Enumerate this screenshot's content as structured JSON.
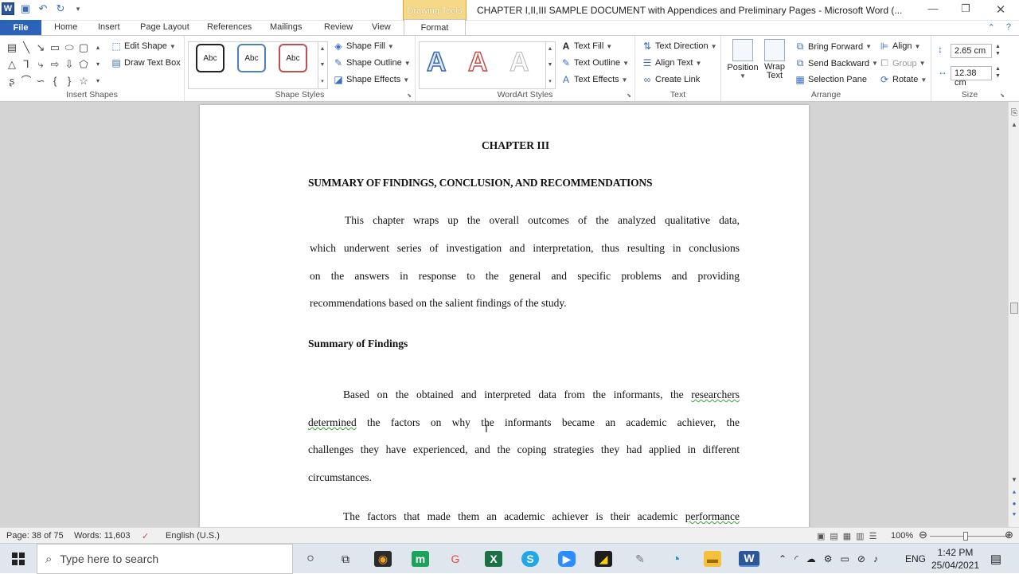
{
  "titlebar": {
    "app_icon": "W",
    "context_tab": "Drawing Tools",
    "title": "CHAPTER I,II,III SAMPLE DOCUMENT with Appendices and Preliminary Pages  -  Microsoft Word (..."
  },
  "tabs": [
    "File",
    "Home",
    "Insert",
    "Page Layout",
    "References",
    "Mailings",
    "Review",
    "View",
    "Format"
  ],
  "ribbon": {
    "insert_shapes": {
      "label": "Insert Shapes",
      "edit_shape": "Edit Shape",
      "draw_text_box": "Draw Text Box"
    },
    "shape_styles": {
      "label": "Shape Styles",
      "sample": "Abc",
      "fill": "Shape Fill",
      "outline": "Shape Outline",
      "effects": "Shape Effects"
    },
    "wordart": {
      "label": "WordArt Styles",
      "letter": "A",
      "text_fill": "Text Fill",
      "text_outline": "Text Outline",
      "text_effects": "Text Effects"
    },
    "text": {
      "label": "Text",
      "direction": "Text Direction",
      "align": "Align Text",
      "link": "Create Link"
    },
    "arrange": {
      "label": "Arrange",
      "position": "Position",
      "wrap_text": "Wrap Text",
      "bring_forward": "Bring Forward",
      "send_backward": "Send Backward",
      "selection_pane": "Selection Pane",
      "align": "Align",
      "group": "Group",
      "rotate": "Rotate"
    },
    "size": {
      "label": "Size",
      "height": "2.65 cm",
      "width": "12.38 cm"
    }
  },
  "document": {
    "chapter": "CHAPTER III",
    "heading": "SUMMARY OF FINDINGS, CONCLUSION, AND RECOMMENDATIONS",
    "para1": [
      "This  chapter  wraps  up  the  overall  outcomes  of  the  analyzed  qualitative  data,",
      "which  underwent  series  of  investigation  and  interpretation,  thus  resulting  in  conclusions",
      "on  the  answers  in  response  to  the  general  and  specific  problems  and  providing",
      "recommendations based on the salient findings of the study."
    ],
    "subheading": "Summary of Findings",
    "para2": {
      "line1_pre": "Based on the obtained and interpreted data from the informants, the ",
      "line1_err": "researchers",
      "line2_err": "determined",
      "line2_post": "  the  factors  on  why  the  informants  became  an  academic  achiever,  the",
      "line3": "challenges they have experienced, and the coping strategies they had applied in different",
      "line4": "circumstances."
    },
    "para3_pre": "The  factors  that  made  them  an  academic  achiever  is  their  academic  ",
    "para3_err": "performance"
  },
  "status": {
    "page": "Page: 38 of 75",
    "words": "Words: 11,603",
    "language": "English (U.S.)",
    "zoom": "100%",
    "zoom_level_percent": 100
  },
  "taskbar": {
    "search_placeholder": "Type here to search",
    "language": "ENG",
    "time": "1:42 PM",
    "date": "25/04/2021"
  }
}
